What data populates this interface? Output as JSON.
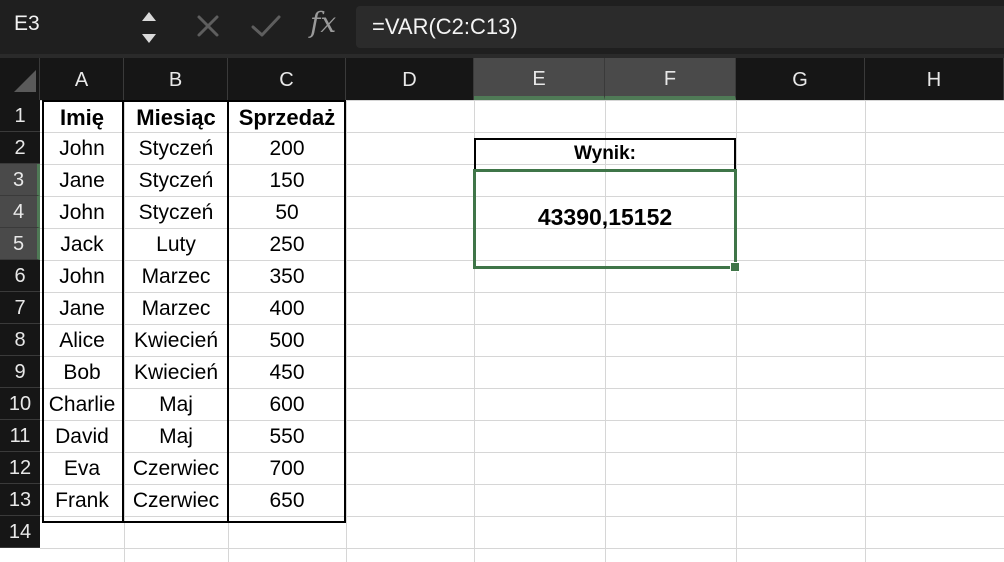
{
  "formula_bar": {
    "name_box": "E3",
    "fx_label": "fx",
    "formula": "=VAR(C2:C13)"
  },
  "columns": [
    "A",
    "B",
    "C",
    "D",
    "E",
    "F",
    "G",
    "H"
  ],
  "selected_columns": [
    "E",
    "F"
  ],
  "rows": [
    "1",
    "2",
    "3",
    "4",
    "5",
    "6",
    "7",
    "8",
    "9",
    "10",
    "11",
    "12",
    "13",
    "14"
  ],
  "selected_rows": [
    "3",
    "4",
    "5"
  ],
  "table": {
    "headers": [
      "Imię",
      "Miesiąc",
      "Sprzedaż"
    ],
    "rows": [
      [
        "John",
        "Styczeń",
        "200"
      ],
      [
        "Jane",
        "Styczeń",
        "150"
      ],
      [
        "John",
        "Styczeń",
        "50"
      ],
      [
        "Jack",
        "Luty",
        "250"
      ],
      [
        "John",
        "Marzec",
        "350"
      ],
      [
        "Jane",
        "Marzec",
        "400"
      ],
      [
        "Alice",
        "Kwiecień",
        "500"
      ],
      [
        "Bob",
        "Kwiecień",
        "450"
      ],
      [
        "Charlie",
        "Maj",
        "600"
      ],
      [
        "David",
        "Maj",
        "550"
      ],
      [
        "Eva",
        "Czerwiec",
        "700"
      ],
      [
        "Frank",
        "Czerwiec",
        "650"
      ]
    ]
  },
  "result": {
    "label": "Wynik:",
    "value": "43390,15152"
  },
  "colors": {
    "selection_accent": "#3f7548",
    "header_bg": "#161616",
    "selected_header_bg": "#4a4a4a"
  }
}
